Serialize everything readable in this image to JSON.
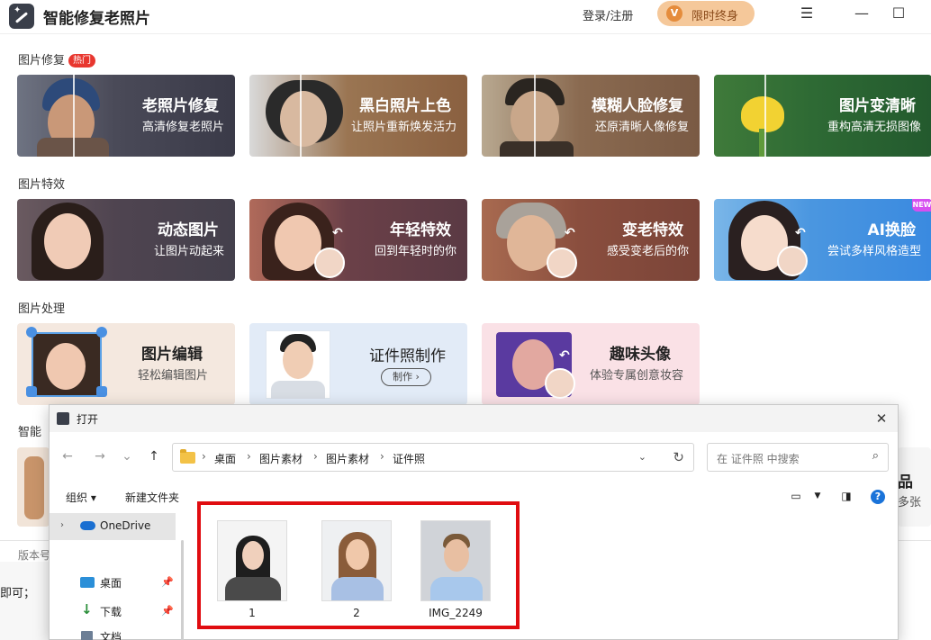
{
  "app": {
    "title": "智能修复老照片",
    "login": "登录/注册",
    "vip_badge": "V",
    "vip_label": "限时终身",
    "menu_icon": "☰",
    "minimize_icon": "—",
    "maximize_icon": "☐"
  },
  "sections": {
    "repair": {
      "title": "图片修复",
      "hot": "热门",
      "cards": [
        {
          "title": "老照片修复",
          "sub": "高清修复老照片"
        },
        {
          "title": "黑白照片上色",
          "sub": "让照片重新焕发活力"
        },
        {
          "title": "模糊人脸修复",
          "sub": "还原清晰人像修复"
        },
        {
          "title": "图片变清晰",
          "sub": "重构高清无损图像"
        }
      ]
    },
    "effects": {
      "title": "图片特效",
      "cards": [
        {
          "title": "动态图片",
          "sub": "让图片动起来"
        },
        {
          "title": "年轻特效",
          "sub": "回到年轻时的你"
        },
        {
          "title": "变老特效",
          "sub": "感受变老后的你"
        },
        {
          "title": "AI换脸",
          "sub": "尝试多样风格造型",
          "badge": "NEW"
        }
      ]
    },
    "processing": {
      "title": "图片处理",
      "cards": [
        {
          "title": "图片编辑",
          "sub": "轻松编辑图片"
        },
        {
          "title": "证件照制作",
          "button": "制作 ›"
        },
        {
          "title": "趣味头像",
          "sub": "体验专属创意妆容"
        }
      ]
    },
    "partial": {
      "title_fragment": "智能",
      "right_fragment_1": "品",
      "right_fragment_2": "多张",
      "footer_fragment": "版本号",
      "left_text_fragment": "即可；"
    }
  },
  "dialog": {
    "title": "打开",
    "close": "✕",
    "nav": {
      "back": "←",
      "forward": "→",
      "recent": "⌄",
      "up": "↑"
    },
    "breadcrumbs": [
      "桌面",
      "图片素材",
      "图片素材",
      "证件照"
    ],
    "crumb_sep": "›",
    "search_placeholder": "在 证件照 中搜索",
    "toolbar": {
      "organize": "组织 ▾",
      "new_folder": "新建文件夹"
    },
    "nav_pane": [
      {
        "label": "OneDrive",
        "selected": true
      },
      {
        "label": "桌面"
      },
      {
        "label": "下载"
      },
      {
        "label": "文档"
      }
    ],
    "files": [
      {
        "name": "1"
      },
      {
        "name": "2"
      },
      {
        "name": "IMG_2249"
      }
    ],
    "colors": {
      "highlight": "#e00c10",
      "accent": "#1a73d9"
    }
  }
}
